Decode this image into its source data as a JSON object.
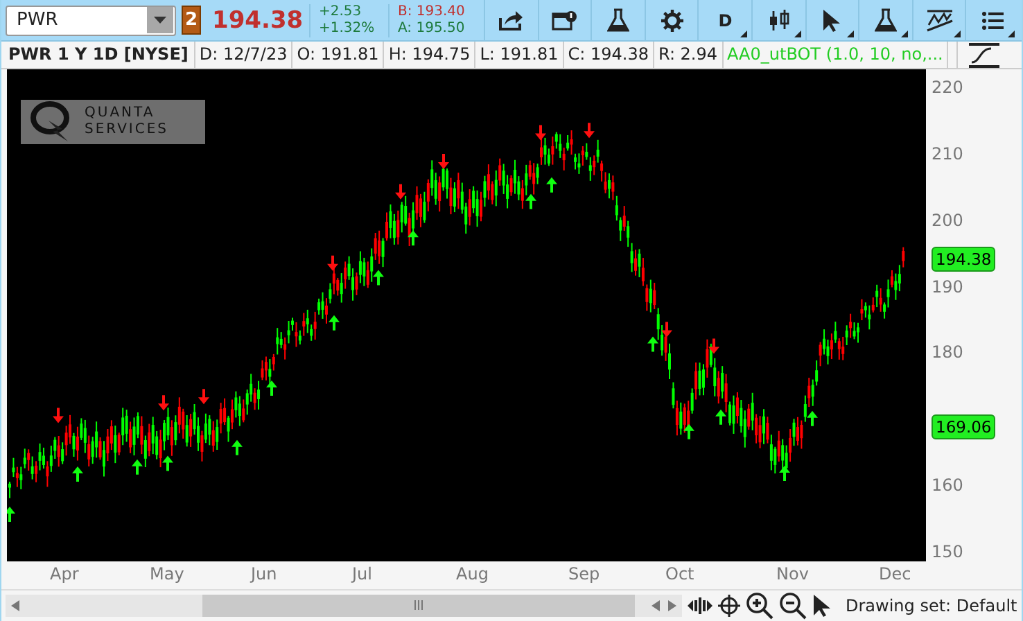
{
  "toolbar": {
    "symbol": "PWR",
    "link_badge": "2",
    "last": "194.38",
    "change": "+2.53",
    "change_pct": "+1.32%",
    "bid": "B: 193.40",
    "ask": "A: 195.50",
    "buttons": [
      {
        "kind": "share",
        "caret": false
      },
      {
        "kind": "calendar",
        "caret": false
      },
      {
        "kind": "flask",
        "caret": false
      },
      {
        "kind": "gear",
        "caret": false
      },
      {
        "kind": "text",
        "label": "D",
        "caret": true
      },
      {
        "kind": "candles",
        "caret": true
      },
      {
        "kind": "cursor",
        "caret": true
      },
      {
        "kind": "flask",
        "caret": true
      },
      {
        "kind": "drawing",
        "caret": true
      },
      {
        "kind": "list",
        "caret": true
      }
    ]
  },
  "info_bar": {
    "title": "PWR 1 Y 1D [NYSE]",
    "cells": [
      "D: 12/7/23",
      "O: 191.81",
      "H: 194.75",
      "L: 191.81",
      "C: 194.38",
      "R: 2.94"
    ],
    "study": "AA0_utBOT (1.0, 10, no,..."
  },
  "chart": {
    "logo": [
      "QUANTA",
      "SERVICES"
    ],
    "price_ticks": [
      "220",
      "210",
      "200",
      "190",
      "180",
      "160",
      "150"
    ],
    "price_tags": [
      {
        "label": "194.38"
      },
      {
        "label": "169.06"
      }
    ],
    "months": [
      "Apr",
      "May",
      "Jun",
      "Jul",
      "Aug",
      "Sep",
      "Oct",
      "Nov",
      "Dec"
    ]
  },
  "footer": {
    "drawing_set": "Drawing set: Default"
  }
}
